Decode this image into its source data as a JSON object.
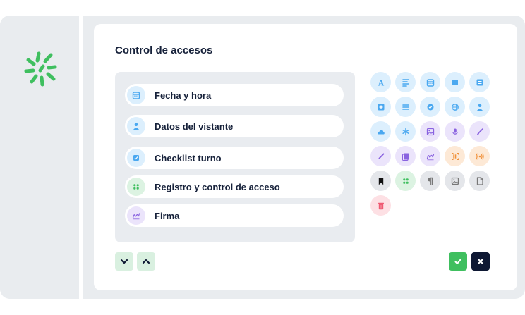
{
  "page": {
    "title": "Control de accesos"
  },
  "list": [
    {
      "label": "Fecha y hora",
      "icon": "calendar-icon",
      "bg": "#dceffd",
      "fg": "#4aa8f0"
    },
    {
      "label": "Datos del vistante",
      "icon": "person-icon",
      "bg": "#dceffd",
      "fg": "#4aa8f0"
    },
    {
      "label": "Checklist turno",
      "icon": "checklist-icon",
      "bg": "#dceffd",
      "fg": "#4aa8f0"
    },
    {
      "label": "Registro y control de acceso",
      "icon": "grid-dots-icon",
      "bg": "#dcf3e2",
      "fg": "#3fbf5f"
    },
    {
      "label": "Firma",
      "icon": "signature-icon",
      "bg": "#ebe4fb",
      "fg": "#8a63e0"
    }
  ],
  "palette": [
    [
      {
        "icon": "text-icon",
        "bg": "#dceffd",
        "fg": "#4aa8f0"
      },
      {
        "icon": "paragraph-lines-icon",
        "bg": "#dceffd",
        "fg": "#4aa8f0"
      },
      {
        "icon": "calendar-icon",
        "bg": "#dceffd",
        "fg": "#4aa8f0"
      },
      {
        "icon": "square-icon",
        "bg": "#dceffd",
        "fg": "#4aa8f0"
      },
      {
        "icon": "list-card-icon",
        "bg": "#dceffd",
        "fg": "#4aa8f0"
      }
    ],
    [
      {
        "icon": "plus-square-icon",
        "bg": "#dceffd",
        "fg": "#4aa8f0"
      },
      {
        "icon": "menu-lines-icon",
        "bg": "#dceffd",
        "fg": "#4aa8f0"
      },
      {
        "icon": "check-circle-icon",
        "bg": "#dceffd",
        "fg": "#4aa8f0"
      },
      {
        "icon": "globe-icon",
        "bg": "#dceffd",
        "fg": "#4aa8f0"
      },
      {
        "icon": "person-icon",
        "bg": "#dceffd",
        "fg": "#4aa8f0"
      }
    ],
    [
      {
        "icon": "cloud-icon",
        "bg": "#dceffd",
        "fg": "#4aa8f0"
      },
      {
        "icon": "asterisk-icon",
        "bg": "#dceffd",
        "fg": "#4aa8f0"
      },
      {
        "icon": "image-icon",
        "bg": "#ebe4fb",
        "fg": "#8a63e0"
      },
      {
        "icon": "microphone-icon",
        "bg": "#ebe4fb",
        "fg": "#8a63e0"
      },
      {
        "icon": "brush-icon",
        "bg": "#ebe4fb",
        "fg": "#8a63e0"
      }
    ],
    [
      {
        "icon": "pen-icon",
        "bg": "#ebe4fb",
        "fg": "#8a63e0"
      },
      {
        "icon": "document-stack-icon",
        "bg": "#ebe4fb",
        "fg": "#8a63e0"
      },
      {
        "icon": "signature-icon",
        "bg": "#ebe4fb",
        "fg": "#8a63e0"
      },
      {
        "icon": "barcode-scan-icon",
        "bg": "#fde9d6",
        "fg": "#f0913a"
      },
      {
        "icon": "nfc-signal-icon",
        "bg": "#fde9d6",
        "fg": "#f0913a"
      }
    ],
    [
      {
        "icon": "bookmark-icon",
        "bg": "#e4e6ea",
        "fg": "#111111"
      },
      {
        "icon": "grid-dots-icon",
        "bg": "#dcf3e2",
        "fg": "#3fbf5f"
      },
      {
        "icon": "pilcrow-icon",
        "bg": "#e4e6ea",
        "fg": "#777777"
      },
      {
        "icon": "image-icon",
        "bg": "#e4e6ea",
        "fg": "#777777"
      },
      {
        "icon": "file-icon",
        "bg": "#e4e6ea",
        "fg": "#777777"
      }
    ],
    [
      {
        "icon": "trash-icon",
        "bg": "#fde0e4",
        "fg": "#ef5a72"
      }
    ]
  ],
  "colors": {
    "brand_green": "#3fbf5f",
    "title_navy": "#16213a",
    "confirm_bg": "#3fbf5f",
    "cancel_bg": "#0e1833"
  }
}
